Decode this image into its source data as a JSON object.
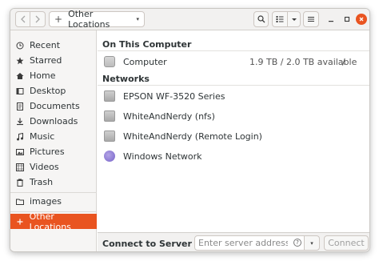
{
  "header": {
    "location_label": "Other Locations",
    "plus_glyph": "+",
    "caret_glyph": "▾"
  },
  "sidebar": {
    "items": [
      {
        "label": "Recent",
        "icon": "clock-icon"
      },
      {
        "label": "Starred",
        "icon": "star-icon"
      },
      {
        "label": "Home",
        "icon": "home-icon"
      },
      {
        "label": "Desktop",
        "icon": "desktop-icon"
      },
      {
        "label": "Documents",
        "icon": "document-icon"
      },
      {
        "label": "Downloads",
        "icon": "download-icon"
      },
      {
        "label": "Music",
        "icon": "music-icon"
      },
      {
        "label": "Pictures",
        "icon": "picture-icon"
      },
      {
        "label": "Videos",
        "icon": "video-icon"
      },
      {
        "label": "Trash",
        "icon": "trash-icon"
      },
      {
        "label": "images",
        "icon": "folder-icon"
      },
      {
        "label": "Other Locations",
        "icon": "plus-icon",
        "active": true
      }
    ]
  },
  "main": {
    "on_this_computer": {
      "heading": "On This Computer",
      "computer": {
        "label": "Computer",
        "size": "1.9 TB / 2.0 TB available",
        "slash": "/"
      }
    },
    "networks": {
      "heading": "Networks",
      "items": [
        {
          "label": "EPSON WF-3520 Series"
        },
        {
          "label": "WhiteAndNerdy (nfs)"
        },
        {
          "label": "WhiteAndNerdy (Remote Login)"
        },
        {
          "label": "Windows Network"
        }
      ]
    }
  },
  "bottom": {
    "connect_label": "Connect to Server",
    "server_placeholder": "Enter server address…",
    "help_glyph": "?",
    "dropdown_glyph": "▾",
    "connect_button": "Connect"
  },
  "colors": {
    "accent": "#e95420",
    "sidebar_bg": "#f6f5f4",
    "header_bg": "#f2f1f0"
  }
}
